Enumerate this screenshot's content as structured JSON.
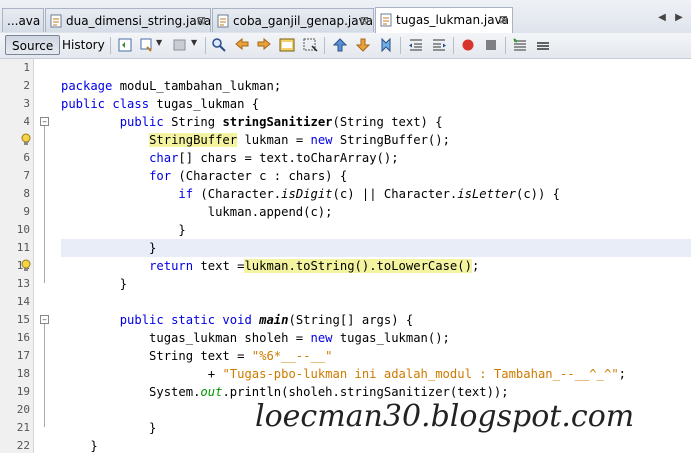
{
  "tabs": [
    {
      "label": "...ava",
      "closable": false,
      "active": false
    },
    {
      "label": "dua_dimensi_string.java",
      "closable": true,
      "active": false
    },
    {
      "label": "coba_ganjil_genap.java",
      "closable": true,
      "active": false
    },
    {
      "label": "tugas_lukman.java",
      "closable": true,
      "active": true
    }
  ],
  "toolbar": {
    "source_label": "Source",
    "history_label": "History"
  },
  "editor": {
    "line_numbers": [
      "1",
      "2",
      "3",
      "4",
      "5",
      "6",
      "7",
      "8",
      "9",
      "10",
      "11",
      "12",
      "13",
      "14",
      "15",
      "16",
      "17",
      "18",
      "19",
      "20",
      "21",
      "22"
    ],
    "lines": [
      "",
      "package moduL_tambahan_lukman;",
      "public class tugas_lukman {",
      "        public String stringSanitizer(String text) {",
      "            StringBuffer lukman = new StringBuffer();",
      "            char[] chars = text.toCharArray();",
      "            for (Character c : chars) {",
      "                if (Character.isDigit(c) || Character.isLetter(c)) {",
      "                    lukman.append(c);",
      "                }",
      "            }",
      "            return text =lukman.toString().toLowerCase();",
      "        }",
      "",
      "        public static void main(String[] args) {",
      "            tugas_lukman sholeh = new tugas_lukman();",
      "            String text = \"%6*__--__\"",
      "                    + \"Tugas-pbo-lukman ini adalah_modul : Tambahan_--__^_^\";",
      "            System.out.println(sholeh.stringSanitizer(text));",
      "",
      "        }",
      "    }"
    ],
    "highlighted_line": 11
  },
  "watermark": "loecman30.blogspot.com"
}
